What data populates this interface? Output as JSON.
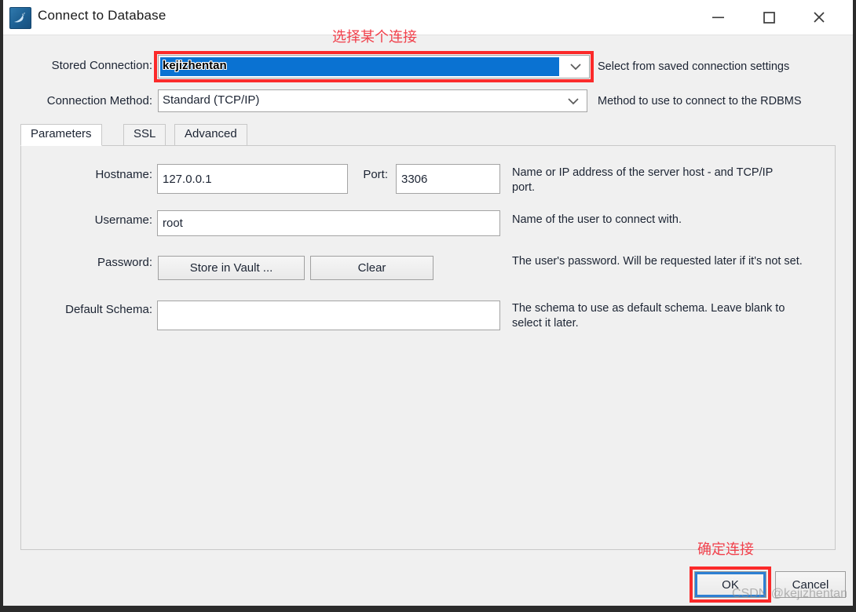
{
  "window": {
    "title": "Connect to Database",
    "icon": "mysql-dolphin-icon",
    "controls": {
      "minimize": "minimize-icon",
      "maximize": "maximize-icon",
      "close": "close-icon"
    }
  },
  "annotations": {
    "top": "选择某个连接",
    "bottom": "确定连接",
    "highlight_color": "#fb2a2a"
  },
  "form": {
    "stored_connection": {
      "label": "Stored Connection:",
      "value": "kejizhentan",
      "hint": "Select from saved connection settings",
      "selection_color": "#0a72d2"
    },
    "connection_method": {
      "label": "Connection Method:",
      "value": "Standard (TCP/IP)",
      "hint": "Method to use to connect to the RDBMS"
    }
  },
  "tabs": [
    {
      "label": "Parameters",
      "active": true
    },
    {
      "label": "SSL",
      "active": false
    },
    {
      "label": "Advanced",
      "active": false
    }
  ],
  "parameters": {
    "hostname": {
      "label": "Hostname:",
      "value": "127.0.0.1",
      "placeholder": ""
    },
    "port": {
      "label": "Port:",
      "value": "3306",
      "placeholder": ""
    },
    "host_hint": "Name or IP address of the server host - and TCP/IP port.",
    "username": {
      "label": "Username:",
      "value": "root",
      "placeholder": ""
    },
    "username_hint": "Name of the user to connect with.",
    "password": {
      "label": "Password:",
      "store_button": "Store in Vault ...",
      "clear_button": "Clear"
    },
    "password_hint": "The user's password. Will be requested later if it's not set.",
    "default_schema": {
      "label": "Default Schema:",
      "value": "",
      "placeholder": ""
    },
    "schema_hint": "The schema to use as default schema. Leave blank to select it later."
  },
  "footer": {
    "ok": "OK",
    "cancel": "Cancel"
  },
  "watermark": "CSDN @kejizhentan"
}
